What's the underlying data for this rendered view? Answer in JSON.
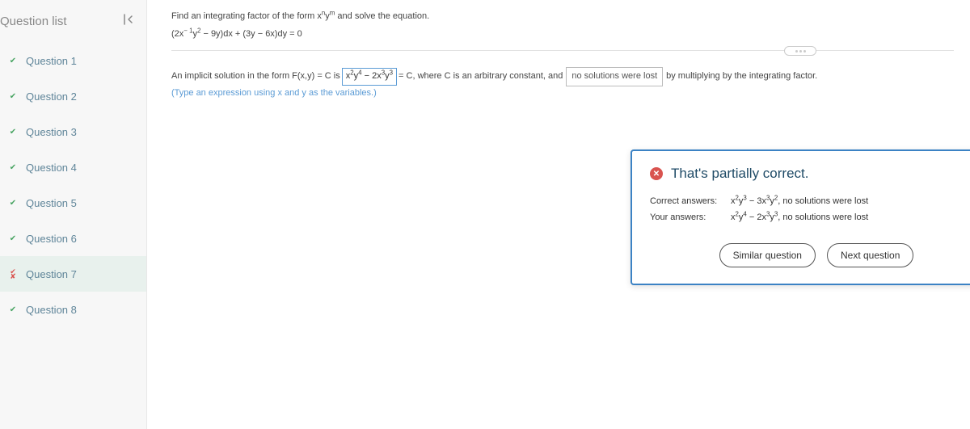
{
  "sidebar": {
    "title": "Question list",
    "items": [
      {
        "label": "Question 1",
        "status": "correct"
      },
      {
        "label": "Question 2",
        "status": "correct"
      },
      {
        "label": "Question 3",
        "status": "correct"
      },
      {
        "label": "Question 4",
        "status": "correct"
      },
      {
        "label": "Question 5",
        "status": "correct"
      },
      {
        "label": "Question 6",
        "status": "correct"
      },
      {
        "label": "Question 7",
        "status": "partial"
      },
      {
        "label": "Question 8",
        "status": "correct"
      }
    ]
  },
  "problem": {
    "prompt_prefix": "Find an integrating factor of the form x",
    "prompt_exp1": "n",
    "prompt_mid": "y",
    "prompt_exp2": "m",
    "prompt_suffix": " and solve the equation.",
    "equation_a": "(2x",
    "equation_e1": "− 1",
    "equation_b": "y",
    "equation_e2": "2",
    "equation_c": " − 9y)dx + (3y − 6x)dy = 0"
  },
  "solution": {
    "pre": "An implicit solution in the form F(x,y) = C is ",
    "ans_a": "x",
    "ans_e1": "2",
    "ans_b": "y",
    "ans_e2": "4",
    "ans_c": " − 2x",
    "ans_e3": "3",
    "ans_d": "y",
    "ans_e4": "3",
    "post1": " = C, where C is an arbitrary constant, and ",
    "dropdown": "no solutions were lost",
    "post2": " by multiplying by the integrating factor.",
    "hint": "(Type an expression using x and y as the variables.)"
  },
  "modal": {
    "title": "That's partially correct.",
    "correct_label": "Correct answers:",
    "correct_a": "x",
    "correct_e1": "2",
    "correct_b": "y",
    "correct_e2": "3",
    "correct_c": " − 3x",
    "correct_e3": "3",
    "correct_d": "y",
    "correct_e4": "2",
    "correct_tail": ", no solutions were lost",
    "your_label": "Your answers:",
    "your_a": "x",
    "your_e1": "2",
    "your_b": "y",
    "your_e2": "4",
    "your_c": " − 2x",
    "your_e3": "3",
    "your_d": "y",
    "your_e4": "3",
    "your_tail": ", no solutions were lost",
    "btn_similar": "Similar question",
    "btn_next": "Next question"
  }
}
